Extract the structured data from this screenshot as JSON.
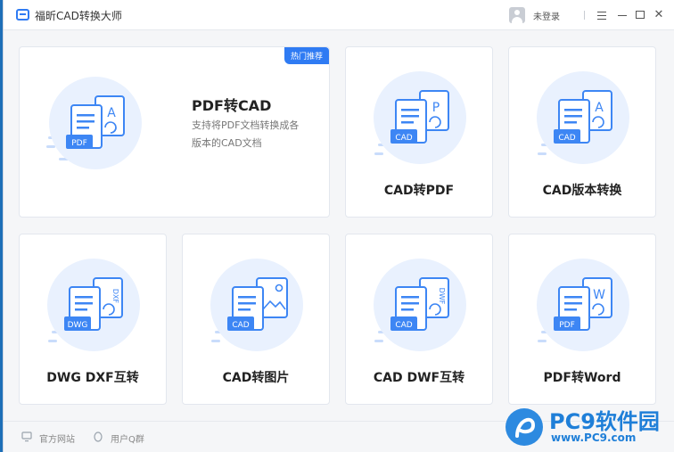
{
  "app": {
    "title": "福昕CAD转换大师"
  },
  "user": {
    "login_text": "未登录"
  },
  "hero": {
    "badge": "热门推荐",
    "title": "PDF转CAD",
    "desc_line1": "支持将PDF文档转换成各",
    "desc_line2": "版本的CAD文档",
    "tag": "PDF",
    "letter": "A"
  },
  "cards": [
    {
      "label": "CAD转PDF",
      "tag": "CAD",
      "letter": "P"
    },
    {
      "label": "CAD版本转换",
      "tag": "CAD",
      "letter": "A"
    },
    {
      "label": "DWG DXF互转",
      "tag": "DWG",
      "letter": "DXF"
    },
    {
      "label": "CAD转图片",
      "tag": "CAD",
      "letter": ""
    },
    {
      "label": "CAD DWF互转",
      "tag": "CAD",
      "letter": "DWF"
    },
    {
      "label": "PDF转Word",
      "tag": "PDF",
      "letter": "W"
    }
  ],
  "footer": {
    "website": "官方网站",
    "qq_group": "用户Q群"
  },
  "watermark": {
    "brand": "PC9软件园",
    "url": "www.PC9.com"
  },
  "colors": {
    "accent": "#2f7bf3",
    "tag": "#3d86f4",
    "circle": "#e9f1fe"
  }
}
